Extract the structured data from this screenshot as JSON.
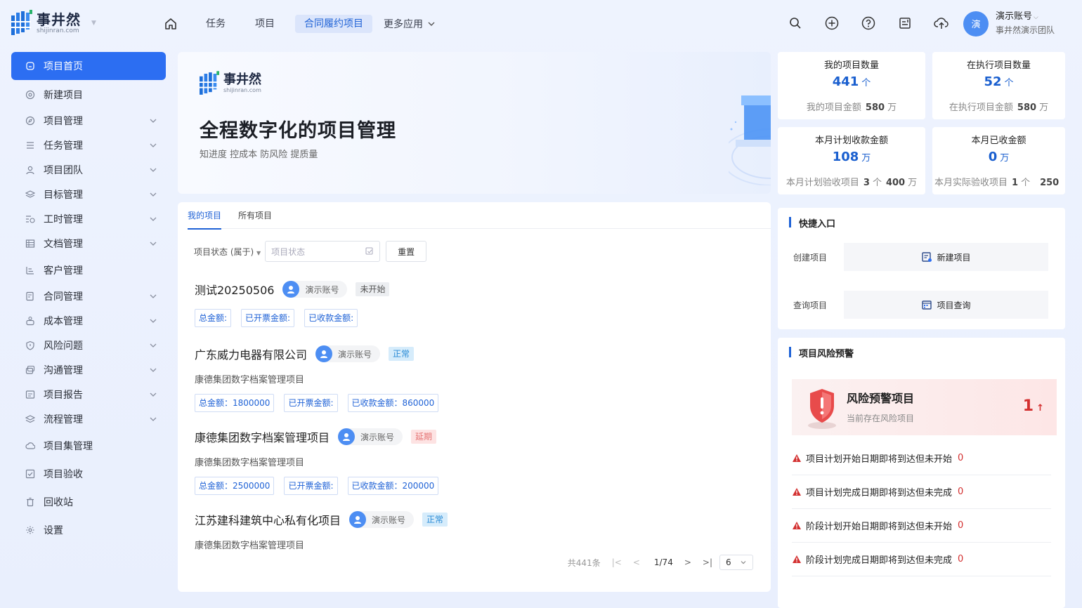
{
  "header": {
    "logo_cn": "事井然",
    "logo_en": "shijinran.com",
    "nav": [
      "任务",
      "项目",
      "合同履约项目"
    ],
    "nav_active": "合同履约项目",
    "nav_more": "更多应用",
    "user_avatar": "演",
    "user_name": "演示账号",
    "user_team": "事井然演示团队",
    "icons": [
      "search-icon",
      "plus-circle-icon",
      "help-icon",
      "list-edit-icon",
      "cloud-upload-icon"
    ]
  },
  "sidebar": {
    "items": [
      {
        "label": "项目首页",
        "icon": "home-icon",
        "active": true
      },
      {
        "label": "新建项目",
        "icon": "at-icon"
      },
      {
        "label": "项目管理",
        "icon": "compass-icon",
        "chevron": true
      },
      {
        "label": "任务管理",
        "icon": "list-icon",
        "chevron": true
      },
      {
        "label": "项目团队",
        "icon": "user-icon",
        "chevron": true
      },
      {
        "label": "目标管理",
        "icon": "layers-icon",
        "chevron": true
      },
      {
        "label": "工时管理",
        "icon": "clock-list-icon",
        "chevron": true
      },
      {
        "label": "文档管理",
        "icon": "table-icon",
        "chevron": true
      },
      {
        "label": "客户管理",
        "icon": "customer-icon"
      },
      {
        "label": "合同管理",
        "icon": "contract-icon",
        "chevron": true
      },
      {
        "label": "成本管理",
        "icon": "cost-icon",
        "chevron": true
      },
      {
        "label": "风险问题",
        "icon": "shield-icon",
        "chevron": true
      },
      {
        "label": "沟通管理",
        "icon": "chat-icon",
        "chevron": true
      },
      {
        "label": "项目报告",
        "icon": "report-icon",
        "chevron": true
      },
      {
        "label": "流程管理",
        "icon": "flow-icon",
        "chevron": true
      },
      {
        "label": "项目集管理",
        "icon": "cloud-icon"
      },
      {
        "label": "项目验收",
        "icon": "check-box-icon"
      },
      {
        "label": "回收站",
        "icon": "trash-icon"
      },
      {
        "label": "设置",
        "icon": "gear-icon"
      }
    ]
  },
  "banner": {
    "logo_cn": "事井然",
    "logo_en": "shijinran.com",
    "title": "全程数字化的项目管理",
    "subtitle": "知进度 控成本 防风险 提质量"
  },
  "stats": [
    {
      "title": "我的项目数量",
      "value": "441",
      "unit": "个",
      "foot_label": "我的项目金额",
      "foot_value": "580",
      "foot_unit": "万"
    },
    {
      "title": "在执行项目数量",
      "value": "52",
      "unit": "个",
      "foot_label": "在执行项目金额",
      "foot_value": "580",
      "foot_unit": "万"
    },
    {
      "title": "本月计划收款金额",
      "value": "108",
      "unit": "万",
      "foot_label": "本月计划验收项目",
      "foot_value": "3",
      "foot_unit": "个",
      "foot_value2": "400",
      "foot_unit2": "万"
    },
    {
      "title": "本月已收金额",
      "value": "0",
      "unit": "万",
      "foot_label": "本月实际验收项目",
      "foot_value": "1",
      "foot_unit": "个",
      "foot_value2": "250"
    }
  ],
  "projects_panel": {
    "tabs": [
      "我的项目",
      "所有项目"
    ],
    "filter_label": "项目状态 (属于)",
    "filter_placeholder": "项目状态",
    "reset_label": "重置",
    "items": [
      {
        "name": "测试20250506",
        "owner": "演示账号",
        "status": "未开始",
        "desc": "",
        "tags": [
          "总金额:",
          "已开票金额:",
          "已收款金额:"
        ]
      },
      {
        "name": "广东威力电器有限公司",
        "owner": "演示账号",
        "status": "正常",
        "desc": "康德集团数字档案管理项目",
        "tags": [
          "总金额：1800000",
          "已开票金额:",
          "已收款金额：860000"
        ]
      },
      {
        "name": "康德集团数字档案管理项目",
        "owner": "演示账号",
        "status": "延期",
        "desc": "康德集团数字档案管理项目",
        "tags": [
          "总金额：2500000",
          "已开票金额:",
          "已收款金额：200000"
        ]
      },
      {
        "name": "江苏建科建筑中心私有化项目",
        "owner": "演示账号",
        "status": "正常",
        "desc": "康德集团数字档案管理项目",
        "tags": []
      }
    ],
    "pager": {
      "total": "共441条",
      "page": "1/74",
      "size": "6"
    }
  },
  "quick": {
    "title": "快捷入口",
    "rows": [
      {
        "label": "创建项目",
        "button": "新建项目"
      },
      {
        "label": "查询项目",
        "button": "项目查询"
      }
    ]
  },
  "risk": {
    "title": "项目风险预警",
    "card_title": "风险预警项目",
    "card_sub": "当前存在风险项目",
    "card_value": "1",
    "lines": [
      {
        "text": "项目计划开始日期即将到达但未开始",
        "value": "0"
      },
      {
        "text": "项目计划完成日期即将到达但未完成",
        "value": "0"
      },
      {
        "text": "阶段计划开始日期即将到达但未开始",
        "value": "0"
      },
      {
        "text": "阶段计划完成日期即将到达但未完成",
        "value": "0"
      }
    ]
  },
  "colors": {
    "accent": "#2c6ef2",
    "danger": "#d32f2f",
    "link": "#1f62d6"
  }
}
